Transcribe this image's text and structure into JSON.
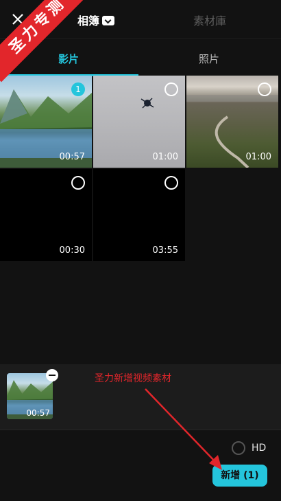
{
  "top_tabs": {
    "album": "相簿",
    "materials": "素材庫"
  },
  "ribbon": "圣力专测",
  "sub_tabs": {
    "videos": "影片",
    "photos": "照片"
  },
  "media": [
    {
      "duration": "00:57",
      "selected_index": "1",
      "selected": true
    },
    {
      "duration": "01:00",
      "selected_index": "",
      "selected": false
    },
    {
      "duration": "01:00",
      "selected_index": "",
      "selected": false
    },
    {
      "duration": "00:30",
      "selected_index": "",
      "selected": false
    },
    {
      "duration": "03:55",
      "selected_index": "",
      "selected": false
    }
  ],
  "tray": {
    "duration": "00:57"
  },
  "annotation": "圣力新增视频素材",
  "footer": {
    "hd_label": "HD",
    "add_button": "新增 (1)"
  },
  "colors": {
    "accent": "#24c5dc",
    "annotation": "#e2262b",
    "background": "#121212"
  }
}
